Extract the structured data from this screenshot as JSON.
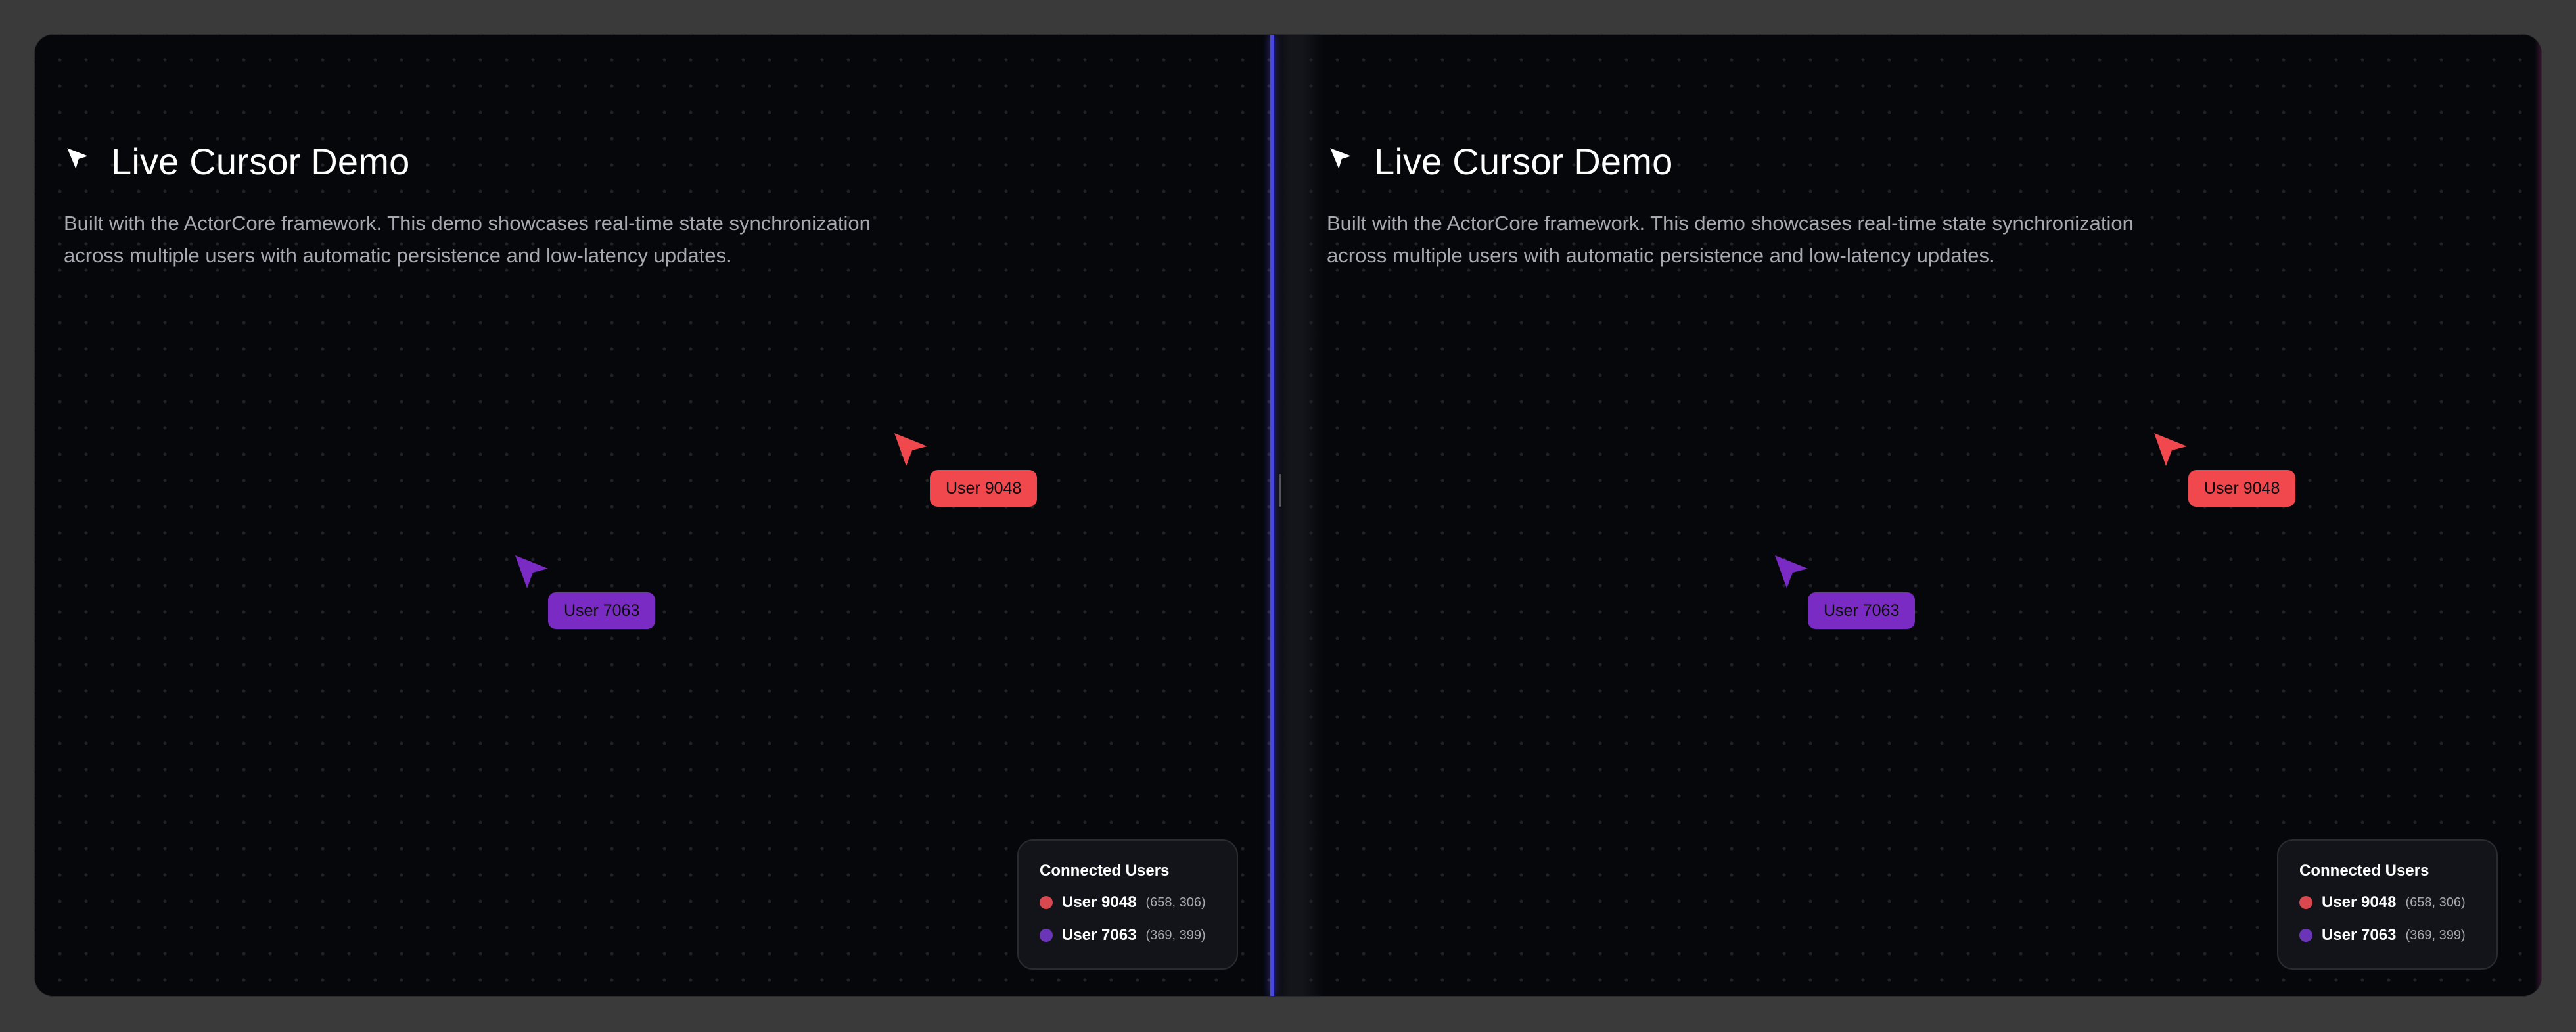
{
  "title": "Live Cursor Demo",
  "description_line1": "Built with the ActorCore framework. This demo showcases real-time state synchronization",
  "description_line2": "across multiple users with automatic persistence and low-latency updates.",
  "connected_title": "Connected Users",
  "users": [
    {
      "name": "User 9048",
      "coords": "(658, 306)",
      "color": "#f0484c",
      "dot_color": "#d9474f"
    },
    {
      "name": "User 7063",
      "coords": "(369, 399)",
      "color": "#7a2bc4",
      "dot_color": "#6b35b8"
    }
  ],
  "colors": {
    "background": "#06070b",
    "divider": "#4a46e0"
  }
}
